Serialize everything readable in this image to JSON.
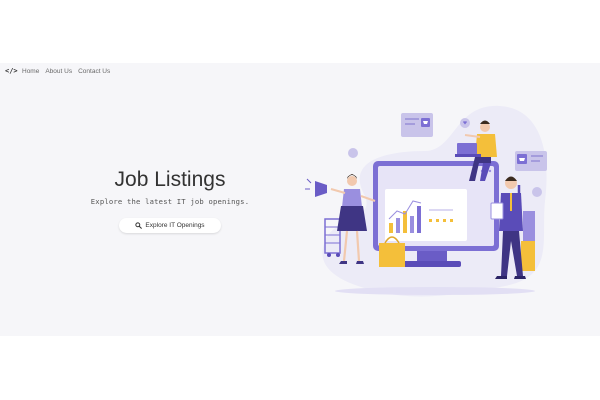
{
  "nav": {
    "brand": "</>",
    "links": [
      "Home",
      "About Us",
      "Contact Us"
    ]
  },
  "hero": {
    "title": "Job Listings",
    "subtitle": "Explore the latest IT job openings.",
    "button_label": "Explore IT Openings"
  },
  "colors": {
    "accent": "#7c6fd4",
    "accent_light": "#e7e4f7",
    "yellow": "#f4bf3a",
    "background": "#f6f6f9"
  },
  "icons": {
    "brand": "code-icon",
    "button": "search-icon"
  }
}
